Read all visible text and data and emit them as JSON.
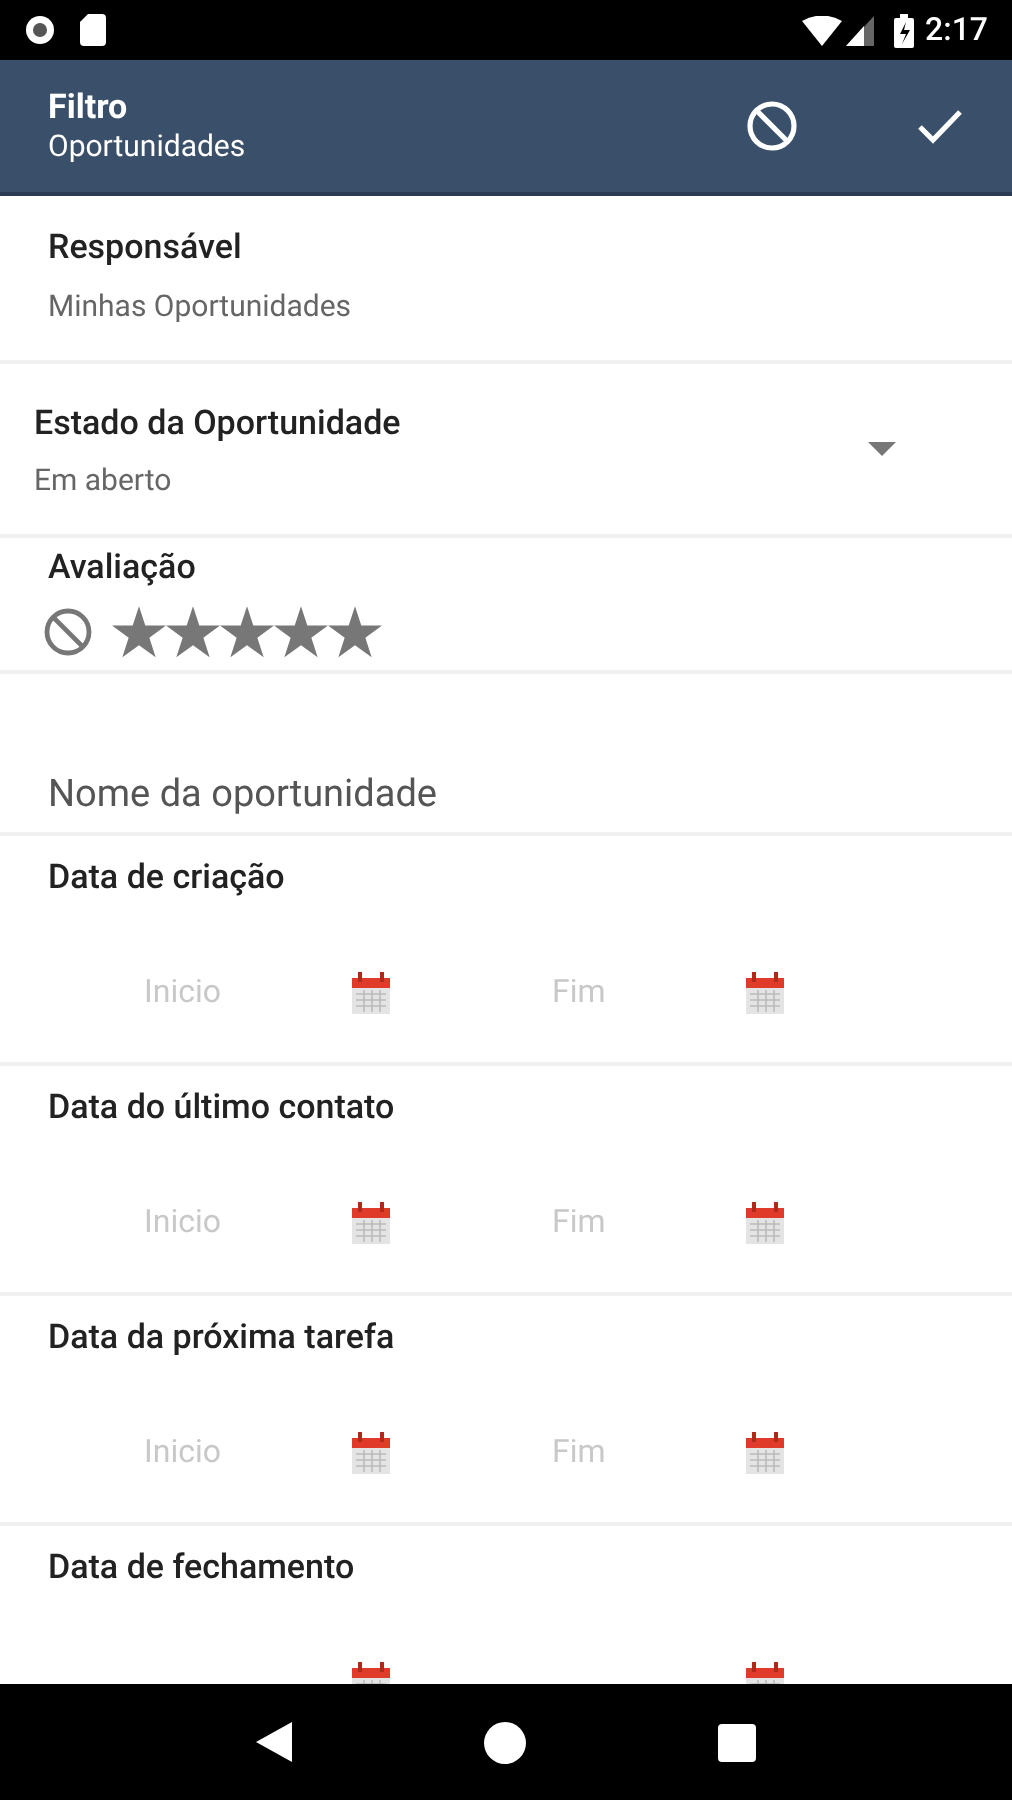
{
  "status_bar": {
    "time": "2:17"
  },
  "app_bar": {
    "title": "Filtro",
    "subtitle": "Oportunidades"
  },
  "responsavel": {
    "label": "Responsável",
    "value": "Minhas Oportunidades"
  },
  "estado": {
    "label": "Estado da Oportunidade",
    "value": "Em aberto"
  },
  "avaliacao": {
    "label": "Avaliação",
    "stars": 5
  },
  "nome": {
    "placeholder": "Nome da oportunidade"
  },
  "date_filters": [
    {
      "label": "Data de criação",
      "start_placeholder": "Inicio",
      "end_placeholder": "Fim"
    },
    {
      "label": "Data do último contato",
      "start_placeholder": "Inicio",
      "end_placeholder": "Fim"
    },
    {
      "label": "Data da próxima tarefa",
      "start_placeholder": "Inicio",
      "end_placeholder": "Fim"
    },
    {
      "label": "Data de fechamento"
    }
  ]
}
